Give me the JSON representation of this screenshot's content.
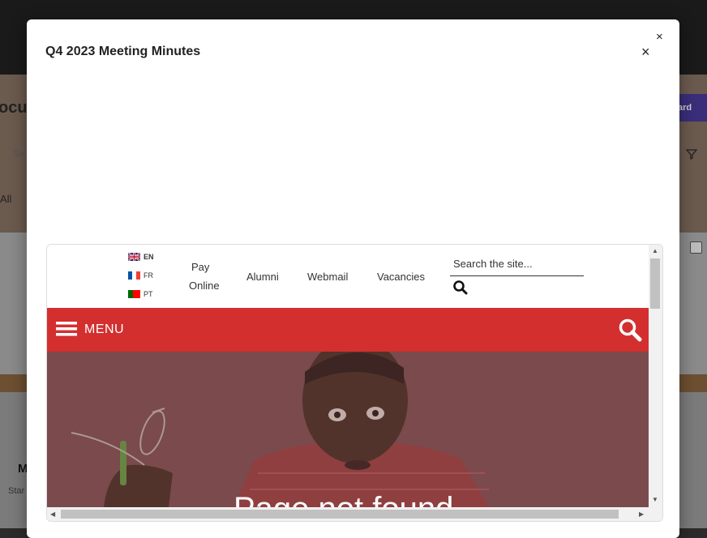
{
  "modal": {
    "title": "Q4 2023 Meeting Minutes",
    "close_symbol": "×"
  },
  "background": {
    "page_title_fragment": "ocu",
    "search_fragment": "Se",
    "filter_fragment": "All",
    "button_fragment": "ard",
    "card_title_fragment": "M",
    "card_sub_fragment": "Star"
  },
  "site": {
    "languages": [
      {
        "code": "EN",
        "flag": "uk-flag-icon",
        "active": true
      },
      {
        "code": "FR",
        "flag": "france-flag-icon",
        "active": false
      },
      {
        "code": "PT",
        "flag": "portugal-flag-icon",
        "active": false
      }
    ],
    "nav": {
      "pay_line1": "Pay",
      "pay_line2": "Online",
      "alumni": "Alumni",
      "webmail": "Webmail",
      "vacancies": "Vacancies"
    },
    "search_placeholder": "Search the site...",
    "menu_label": "MENU",
    "hero_title": "Page not found",
    "colors": {
      "menubar": "#d32f2f",
      "hero_overlay": "#7b4a4e"
    }
  }
}
